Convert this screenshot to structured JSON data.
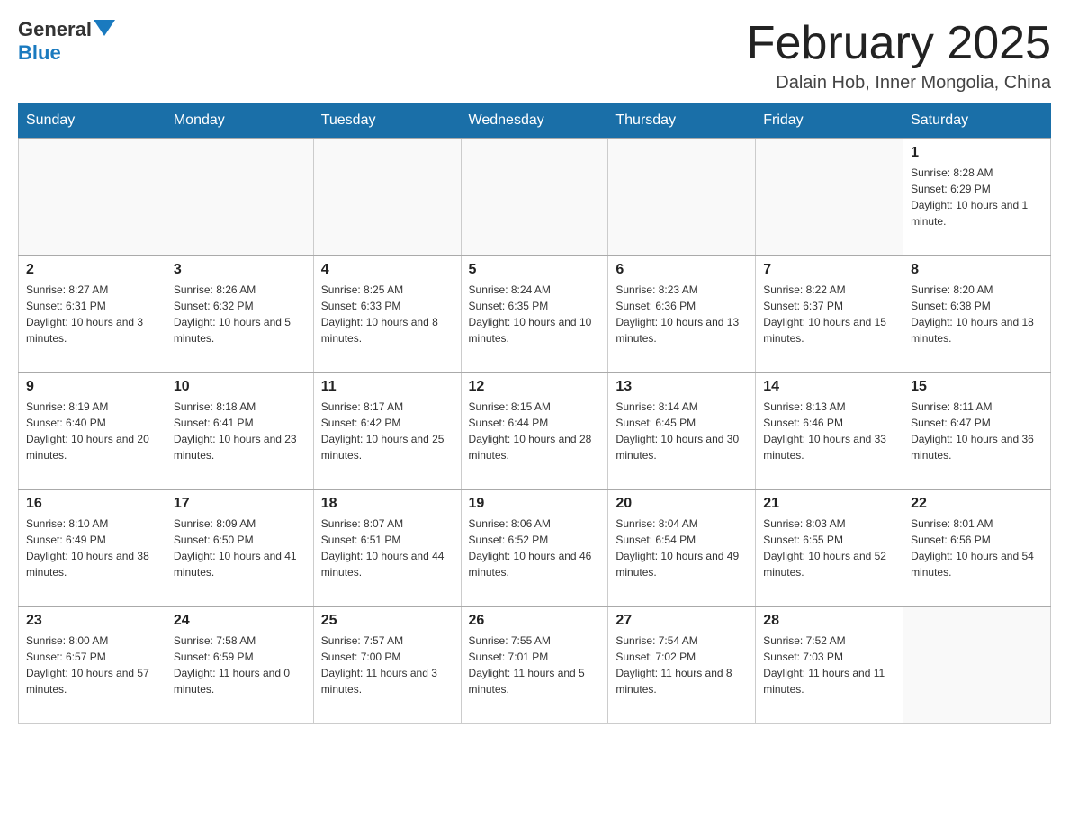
{
  "header": {
    "logo_general": "General",
    "logo_blue": "Blue",
    "month_title": "February 2025",
    "location": "Dalain Hob, Inner Mongolia, China"
  },
  "days_of_week": [
    "Sunday",
    "Monday",
    "Tuesday",
    "Wednesday",
    "Thursday",
    "Friday",
    "Saturday"
  ],
  "weeks": [
    [
      null,
      null,
      null,
      null,
      null,
      null,
      {
        "day": "1",
        "sunrise": "Sunrise: 8:28 AM",
        "sunset": "Sunset: 6:29 PM",
        "daylight": "Daylight: 10 hours and 1 minute."
      }
    ],
    [
      {
        "day": "2",
        "sunrise": "Sunrise: 8:27 AM",
        "sunset": "Sunset: 6:31 PM",
        "daylight": "Daylight: 10 hours and 3 minutes."
      },
      {
        "day": "3",
        "sunrise": "Sunrise: 8:26 AM",
        "sunset": "Sunset: 6:32 PM",
        "daylight": "Daylight: 10 hours and 5 minutes."
      },
      {
        "day": "4",
        "sunrise": "Sunrise: 8:25 AM",
        "sunset": "Sunset: 6:33 PM",
        "daylight": "Daylight: 10 hours and 8 minutes."
      },
      {
        "day": "5",
        "sunrise": "Sunrise: 8:24 AM",
        "sunset": "Sunset: 6:35 PM",
        "daylight": "Daylight: 10 hours and 10 minutes."
      },
      {
        "day": "6",
        "sunrise": "Sunrise: 8:23 AM",
        "sunset": "Sunset: 6:36 PM",
        "daylight": "Daylight: 10 hours and 13 minutes."
      },
      {
        "day": "7",
        "sunrise": "Sunrise: 8:22 AM",
        "sunset": "Sunset: 6:37 PM",
        "daylight": "Daylight: 10 hours and 15 minutes."
      },
      {
        "day": "8",
        "sunrise": "Sunrise: 8:20 AM",
        "sunset": "Sunset: 6:38 PM",
        "daylight": "Daylight: 10 hours and 18 minutes."
      }
    ],
    [
      {
        "day": "9",
        "sunrise": "Sunrise: 8:19 AM",
        "sunset": "Sunset: 6:40 PM",
        "daylight": "Daylight: 10 hours and 20 minutes."
      },
      {
        "day": "10",
        "sunrise": "Sunrise: 8:18 AM",
        "sunset": "Sunset: 6:41 PM",
        "daylight": "Daylight: 10 hours and 23 minutes."
      },
      {
        "day": "11",
        "sunrise": "Sunrise: 8:17 AM",
        "sunset": "Sunset: 6:42 PM",
        "daylight": "Daylight: 10 hours and 25 minutes."
      },
      {
        "day": "12",
        "sunrise": "Sunrise: 8:15 AM",
        "sunset": "Sunset: 6:44 PM",
        "daylight": "Daylight: 10 hours and 28 minutes."
      },
      {
        "day": "13",
        "sunrise": "Sunrise: 8:14 AM",
        "sunset": "Sunset: 6:45 PM",
        "daylight": "Daylight: 10 hours and 30 minutes."
      },
      {
        "day": "14",
        "sunrise": "Sunrise: 8:13 AM",
        "sunset": "Sunset: 6:46 PM",
        "daylight": "Daylight: 10 hours and 33 minutes."
      },
      {
        "day": "15",
        "sunrise": "Sunrise: 8:11 AM",
        "sunset": "Sunset: 6:47 PM",
        "daylight": "Daylight: 10 hours and 36 minutes."
      }
    ],
    [
      {
        "day": "16",
        "sunrise": "Sunrise: 8:10 AM",
        "sunset": "Sunset: 6:49 PM",
        "daylight": "Daylight: 10 hours and 38 minutes."
      },
      {
        "day": "17",
        "sunrise": "Sunrise: 8:09 AM",
        "sunset": "Sunset: 6:50 PM",
        "daylight": "Daylight: 10 hours and 41 minutes."
      },
      {
        "day": "18",
        "sunrise": "Sunrise: 8:07 AM",
        "sunset": "Sunset: 6:51 PM",
        "daylight": "Daylight: 10 hours and 44 minutes."
      },
      {
        "day": "19",
        "sunrise": "Sunrise: 8:06 AM",
        "sunset": "Sunset: 6:52 PM",
        "daylight": "Daylight: 10 hours and 46 minutes."
      },
      {
        "day": "20",
        "sunrise": "Sunrise: 8:04 AM",
        "sunset": "Sunset: 6:54 PM",
        "daylight": "Daylight: 10 hours and 49 minutes."
      },
      {
        "day": "21",
        "sunrise": "Sunrise: 8:03 AM",
        "sunset": "Sunset: 6:55 PM",
        "daylight": "Daylight: 10 hours and 52 minutes."
      },
      {
        "day": "22",
        "sunrise": "Sunrise: 8:01 AM",
        "sunset": "Sunset: 6:56 PM",
        "daylight": "Daylight: 10 hours and 54 minutes."
      }
    ],
    [
      {
        "day": "23",
        "sunrise": "Sunrise: 8:00 AM",
        "sunset": "Sunset: 6:57 PM",
        "daylight": "Daylight: 10 hours and 57 minutes."
      },
      {
        "day": "24",
        "sunrise": "Sunrise: 7:58 AM",
        "sunset": "Sunset: 6:59 PM",
        "daylight": "Daylight: 11 hours and 0 minutes."
      },
      {
        "day": "25",
        "sunrise": "Sunrise: 7:57 AM",
        "sunset": "Sunset: 7:00 PM",
        "daylight": "Daylight: 11 hours and 3 minutes."
      },
      {
        "day": "26",
        "sunrise": "Sunrise: 7:55 AM",
        "sunset": "Sunset: 7:01 PM",
        "daylight": "Daylight: 11 hours and 5 minutes."
      },
      {
        "day": "27",
        "sunrise": "Sunrise: 7:54 AM",
        "sunset": "Sunset: 7:02 PM",
        "daylight": "Daylight: 11 hours and 8 minutes."
      },
      {
        "day": "28",
        "sunrise": "Sunrise: 7:52 AM",
        "sunset": "Sunset: 7:03 PM",
        "daylight": "Daylight: 11 hours and 11 minutes."
      },
      null
    ]
  ]
}
